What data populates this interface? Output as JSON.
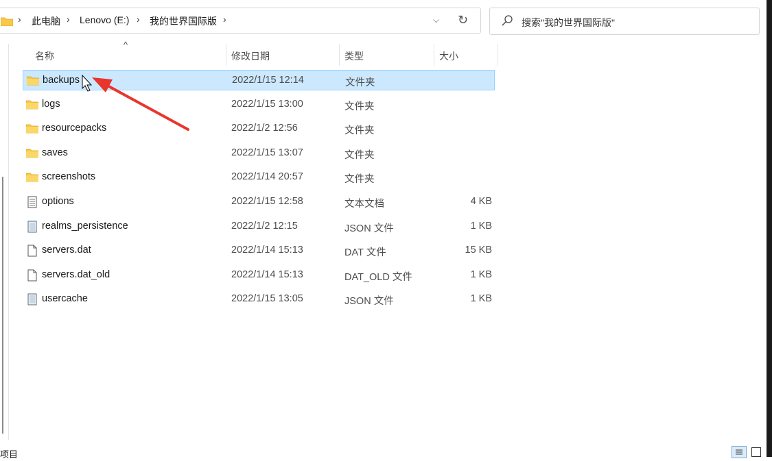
{
  "address": {
    "crumbs": [
      "此电脑",
      "Lenovo (E:)",
      "我的世界国际版"
    ],
    "separator": "›",
    "dropdown_glyph": "⌵",
    "refresh_glyph": "↻",
    "folder_icon": "folder-icon"
  },
  "search": {
    "placeholder": "搜索\"我的世界国际版\"",
    "icon": "search-icon"
  },
  "columns": {
    "name": "名称",
    "date": "修改日期",
    "type": "类型",
    "size": "大小",
    "sort_glyph": "^"
  },
  "files": [
    {
      "name": "backups",
      "date": "2022/1/15 12:14",
      "type": "文件夹",
      "size": "",
      "icon": "folder-icon",
      "selected": true
    },
    {
      "name": "logs",
      "date": "2022/1/15 13:00",
      "type": "文件夹",
      "size": "",
      "icon": "folder-icon"
    },
    {
      "name": "resourcepacks",
      "date": "2022/1/2 12:56",
      "type": "文件夹",
      "size": "",
      "icon": "folder-icon"
    },
    {
      "name": "saves",
      "date": "2022/1/15 13:07",
      "type": "文件夹",
      "size": "",
      "icon": "folder-icon"
    },
    {
      "name": "screenshots",
      "date": "2022/1/14 20:57",
      "type": "文件夹",
      "size": "",
      "icon": "folder-icon"
    },
    {
      "name": "options",
      "date": "2022/1/15 12:58",
      "type": "文本文档",
      "size": "4 KB",
      "icon": "text-document-icon"
    },
    {
      "name": "realms_persistence",
      "date": "2022/1/2 12:15",
      "type": "JSON 文件",
      "size": "1 KB",
      "icon": "json-file-icon"
    },
    {
      "name": "servers.dat",
      "date": "2022/1/14 15:13",
      "type": "DAT 文件",
      "size": "15 KB",
      "icon": "blank-file-icon"
    },
    {
      "name": "servers.dat_old",
      "date": "2022/1/14 15:13",
      "type": "DAT_OLD 文件",
      "size": "1 KB",
      "icon": "blank-file-icon"
    },
    {
      "name": "usercache",
      "date": "2022/1/15 13:05",
      "type": "JSON 文件",
      "size": "1 KB",
      "icon": "json-file-icon"
    }
  ],
  "status": {
    "items_text": "项目"
  },
  "colors": {
    "selection_bg": "#cce8ff",
    "selection_border": "#99d1ff",
    "folder_yellow": "#f8c948",
    "annotation_red": "#e8362d"
  }
}
